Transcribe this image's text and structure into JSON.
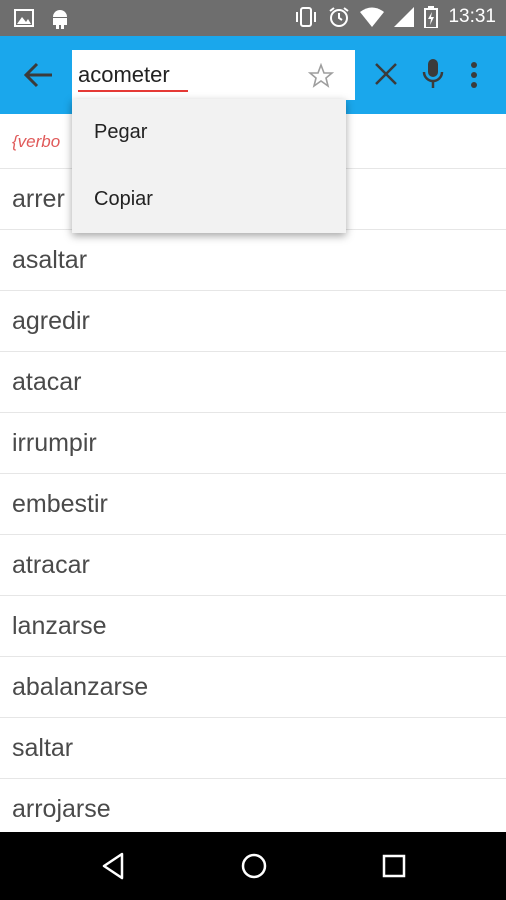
{
  "status_bar": {
    "time": "13:31",
    "left_icons": [
      "image-icon",
      "android-icon"
    ],
    "right_icons": [
      "vibrate-icon",
      "alarm-icon",
      "wifi-icon",
      "signal-icon",
      "battery-icon"
    ]
  },
  "app_bar": {
    "color": "#1aa7ec",
    "search_value": "acometer"
  },
  "results": {
    "part_of_speech": "{verbo",
    "items": [
      "arrer",
      "asaltar",
      "agredir",
      "atacar",
      "irrumpir",
      "embestir",
      "atracar",
      "lanzarse",
      "abalanzarse",
      "saltar",
      "arrojarse"
    ]
  },
  "context_menu": {
    "items": [
      "Pegar",
      "Copiar"
    ]
  }
}
